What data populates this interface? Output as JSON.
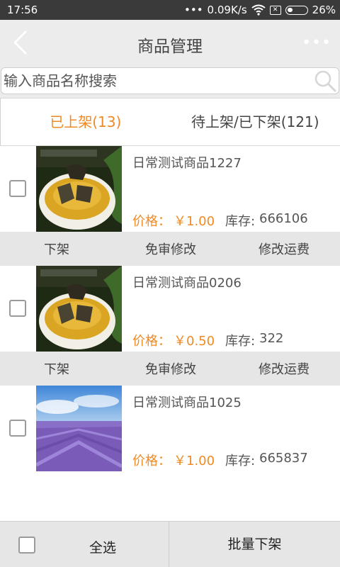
{
  "status_bar": {
    "time": "17:56",
    "network_speed": "0.09K/s",
    "battery": "26%"
  },
  "header": {
    "title": "商品管理",
    "back_icon": "back-arrow-icon",
    "more_icon": "more-dots-icon"
  },
  "search": {
    "placeholder": "输入商品名称搜索",
    "icon": "search-icon"
  },
  "tabs": [
    {
      "label": "已上架(13)",
      "active": true
    },
    {
      "label": "待上架/已下架(121)",
      "active": false
    }
  ],
  "products": [
    {
      "name": "日常测试商品1227",
      "price_label": "价格：",
      "price": "￥1.00",
      "stock_label": "库存:",
      "stock": "666106"
    },
    {
      "name": "日常测试商品0206",
      "price_label": "价格：",
      "price": "￥0.50",
      "stock_label": "库存:",
      "stock": "322"
    },
    {
      "name": "日常测试商品1025",
      "price_label": "价格：",
      "price": "￥1.00",
      "stock_label": "库存:",
      "stock": "665837"
    }
  ],
  "row_actions": {
    "offshelf": "下架",
    "edit": "免审修改",
    "shipping": "修改运费"
  },
  "bottom_bar": {
    "select_all": "全选",
    "batch_offshelf": "批量下架"
  },
  "colors": {
    "accent": "#f08a26",
    "nav_bg": "#ececec",
    "action_bg": "#e6e6e6",
    "status_bg": "#3a3a3a"
  }
}
